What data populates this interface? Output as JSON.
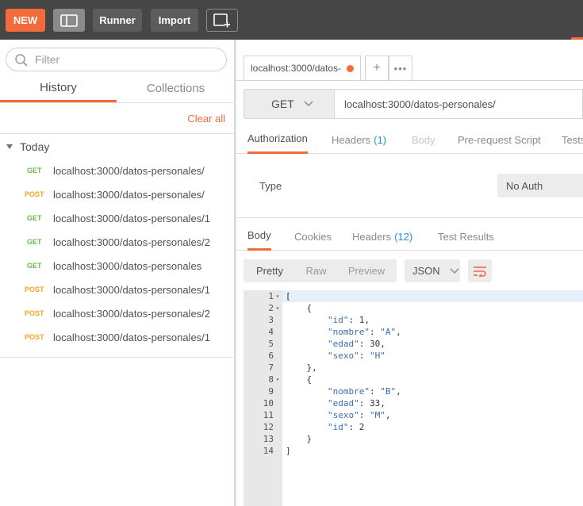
{
  "toolbar": {
    "new_label": "NEW",
    "runner_label": "Runner",
    "import_label": "Import",
    "accent_color": "#f26b3a"
  },
  "sidebar": {
    "filter_placeholder": "Filter",
    "tabs": [
      {
        "label": "History",
        "active": true
      },
      {
        "label": "Collections",
        "active": false
      }
    ],
    "clear_all": "Clear all",
    "group": "Today",
    "history": [
      {
        "method": "GET",
        "url": "localhost:3000/datos-personales/"
      },
      {
        "method": "POST",
        "url": "localhost:3000/datos-personales/"
      },
      {
        "method": "GET",
        "url": "localhost:3000/datos-personales/1"
      },
      {
        "method": "GET",
        "url": "localhost:3000/datos-personales/2"
      },
      {
        "method": "GET",
        "url": "localhost:3000/datos-personales"
      },
      {
        "method": "POST",
        "url": "localhost:3000/datos-personales/1"
      },
      {
        "method": "POST",
        "url": "localhost:3000/datos-personales/2"
      },
      {
        "method": "POST",
        "url": "localhost:3000/datos-personales/1"
      }
    ]
  },
  "request": {
    "tab_title": "localhost:3000/datos-",
    "tab_plus": "+",
    "tab_more": "•••",
    "method": "GET",
    "url": "localhost:3000/datos-personales/",
    "tabs": {
      "authorization": "Authorization",
      "headers": "Headers",
      "headers_count": "(1)",
      "body": "Body",
      "prerequest": "Pre-request Script",
      "tests": "Tests"
    },
    "auth_type_label": "Type",
    "auth_type_value": "No Auth"
  },
  "response": {
    "tabs": {
      "body": "Body",
      "cookies": "Cookies",
      "headers": "Headers",
      "headers_count": "(12)",
      "test_results": "Test Results"
    },
    "view_modes": [
      "Pretty",
      "Raw",
      "Preview"
    ],
    "format": "JSON",
    "lines": [
      "[",
      "    {",
      "        \"id\": 1,",
      "        \"nombre\": \"A\",",
      "        \"edad\": 30,",
      "        \"sexo\": \"H\"",
      "    },",
      "    {",
      "        \"nombre\": \"B\",",
      "        \"edad\": 33,",
      "        \"sexo\": \"M\",",
      "        \"id\": 2",
      "    }",
      "]"
    ],
    "fold_lines": [
      1,
      2,
      8
    ]
  }
}
